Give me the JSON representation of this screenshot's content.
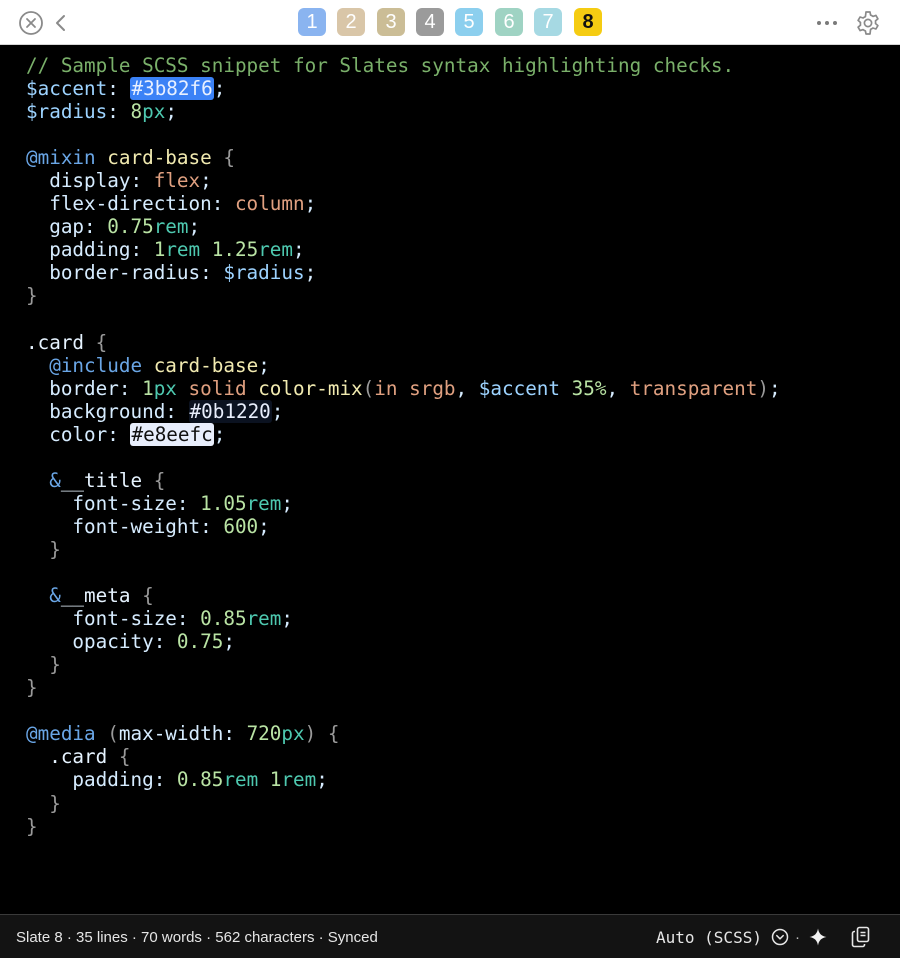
{
  "tabs": [
    {
      "label": "1",
      "color": "#8ab4f0"
    },
    {
      "label": "2",
      "color": "#d9c6a8"
    },
    {
      "label": "3",
      "color": "#cbbd96"
    },
    {
      "label": "4",
      "color": "#9b9b9b"
    },
    {
      "label": "5",
      "color": "#8ccfee"
    },
    {
      "label": "6",
      "color": "#9fd3c3"
    },
    {
      "label": "7",
      "color": "#a6d9e3"
    },
    {
      "label": "8",
      "color": "#f5cc12"
    }
  ],
  "active_tab": "8",
  "icons": {
    "close": "close-circle-icon",
    "back": "chevron-left-icon",
    "more": "more-icon",
    "settings": "gear-icon",
    "mode_dropdown": "chevron-down-circle-icon",
    "sparkle": "sparkle-icon",
    "copy": "copy-icon"
  },
  "swatches": {
    "accent": "#3b82f6",
    "background": "#0b1220",
    "color": "#e8eefc"
  },
  "code_lines": [
    [
      [
        "c-com",
        "// Sample SCSS snippet for Slates syntax highlighting checks."
      ]
    ],
    [
      [
        "c-var",
        "$accent"
      ],
      [
        "c-prop",
        ": "
      ],
      [
        "sw sw-accent",
        "#3b82f6"
      ],
      [
        "c-prop",
        ";"
      ]
    ],
    [
      [
        "c-var",
        "$radius"
      ],
      [
        "c-prop",
        ": "
      ],
      [
        "c-num",
        "8"
      ],
      [
        "c-unit",
        "px"
      ],
      [
        "c-prop",
        ";"
      ]
    ],
    [],
    [
      [
        "c-at",
        "@mixin"
      ],
      [
        "c-prop",
        " "
      ],
      [
        "c-fn",
        "card-base"
      ],
      [
        "c-brace",
        " {"
      ]
    ],
    [
      [
        "c-prop",
        "  display: "
      ],
      [
        "c-kw",
        "flex"
      ],
      [
        "c-prop",
        ";"
      ]
    ],
    [
      [
        "c-prop",
        "  flex-direction: "
      ],
      [
        "c-kw",
        "column"
      ],
      [
        "c-prop",
        ";"
      ]
    ],
    [
      [
        "c-prop",
        "  gap: "
      ],
      [
        "c-num",
        "0.75"
      ],
      [
        "c-unit",
        "rem"
      ],
      [
        "c-prop",
        ";"
      ]
    ],
    [
      [
        "c-prop",
        "  padding: "
      ],
      [
        "c-num",
        "1"
      ],
      [
        "c-unit",
        "rem"
      ],
      [
        "c-prop",
        " "
      ],
      [
        "c-num",
        "1.25"
      ],
      [
        "c-unit",
        "rem"
      ],
      [
        "c-prop",
        ";"
      ]
    ],
    [
      [
        "c-prop",
        "  border-radius: "
      ],
      [
        "c-var",
        "$radius"
      ],
      [
        "c-prop",
        ";"
      ]
    ],
    [
      [
        "c-brace",
        "}"
      ]
    ],
    [],
    [
      [
        "c-sel",
        ".card"
      ],
      [
        "c-brace",
        " {"
      ]
    ],
    [
      [
        "c-prop",
        "  "
      ],
      [
        "c-at",
        "@include"
      ],
      [
        "c-prop",
        " "
      ],
      [
        "c-fn",
        "card-base"
      ],
      [
        "c-prop",
        ";"
      ]
    ],
    [
      [
        "c-prop",
        "  border: "
      ],
      [
        "c-num",
        "1"
      ],
      [
        "c-unit",
        "px"
      ],
      [
        "c-prop",
        " "
      ],
      [
        "c-kw",
        "solid"
      ],
      [
        "c-prop",
        " "
      ],
      [
        "c-fn",
        "color-mix"
      ],
      [
        "c-brace",
        "("
      ],
      [
        "c-kw",
        "in srgb"
      ],
      [
        "c-prop",
        ", "
      ],
      [
        "c-var",
        "$accent"
      ],
      [
        "c-prop",
        " "
      ],
      [
        "c-pct",
        "35%"
      ],
      [
        "c-prop",
        ", "
      ],
      [
        "c-kw",
        "transparent"
      ],
      [
        "c-brace",
        ")"
      ],
      [
        "c-prop",
        ";"
      ]
    ],
    [
      [
        "c-prop",
        "  background: "
      ],
      [
        "sw sw-bg",
        "#0b1220"
      ],
      [
        "c-prop",
        ";"
      ]
    ],
    [
      [
        "c-prop",
        "  color: "
      ],
      [
        "sw sw-fg",
        "#e8eefc"
      ],
      [
        "c-prop",
        ";"
      ]
    ],
    [],
    [
      [
        "c-prop",
        "  "
      ],
      [
        "c-at",
        "&"
      ],
      [
        "c-sel",
        "__title"
      ],
      [
        "c-brace",
        " {"
      ]
    ],
    [
      [
        "c-prop",
        "    font-size: "
      ],
      [
        "c-num",
        "1.05"
      ],
      [
        "c-unit",
        "rem"
      ],
      [
        "c-prop",
        ";"
      ]
    ],
    [
      [
        "c-prop",
        "    font-weight: "
      ],
      [
        "c-num",
        "600"
      ],
      [
        "c-prop",
        ";"
      ]
    ],
    [
      [
        "c-brace",
        "  }"
      ]
    ],
    [],
    [
      [
        "c-prop",
        "  "
      ],
      [
        "c-at",
        "&"
      ],
      [
        "c-sel",
        "__meta"
      ],
      [
        "c-brace",
        " {"
      ]
    ],
    [
      [
        "c-prop",
        "    font-size: "
      ],
      [
        "c-num",
        "0.85"
      ],
      [
        "c-unit",
        "rem"
      ],
      [
        "c-prop",
        ";"
      ]
    ],
    [
      [
        "c-prop",
        "    opacity: "
      ],
      [
        "c-num",
        "0.75"
      ],
      [
        "c-prop",
        ";"
      ]
    ],
    [
      [
        "c-brace",
        "  }"
      ]
    ],
    [
      [
        "c-brace",
        "}"
      ]
    ],
    [],
    [
      [
        "c-at",
        "@media"
      ],
      [
        "c-prop",
        " "
      ],
      [
        "c-brace",
        "("
      ],
      [
        "c-prop",
        "max-width: "
      ],
      [
        "c-num",
        "720"
      ],
      [
        "c-unit",
        "px"
      ],
      [
        "c-brace",
        ")"
      ],
      [
        "c-brace",
        " {"
      ]
    ],
    [
      [
        "c-sel",
        "  .card"
      ],
      [
        "c-brace",
        " {"
      ]
    ],
    [
      [
        "c-prop",
        "    padding: "
      ],
      [
        "c-num",
        "0.85"
      ],
      [
        "c-unit",
        "rem"
      ],
      [
        "c-prop",
        " "
      ],
      [
        "c-num",
        "1"
      ],
      [
        "c-unit",
        "rem"
      ],
      [
        "c-prop",
        ";"
      ]
    ],
    [
      [
        "c-brace",
        "  }"
      ]
    ],
    [
      [
        "c-brace",
        "}"
      ]
    ],
    []
  ],
  "status": {
    "summary": "Slate 8 · 35 lines · 70 words · 562 characters · Synced",
    "mode": "Auto (SCSS)",
    "separator": "·"
  }
}
